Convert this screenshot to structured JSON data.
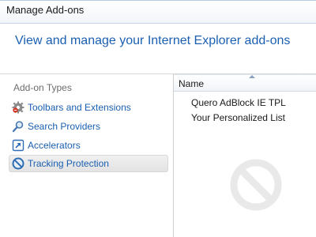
{
  "window": {
    "title": "Manage Add-ons"
  },
  "header": {
    "text": "View and manage your Internet Explorer add-ons"
  },
  "sidebar": {
    "heading": "Add-on Types",
    "items": [
      {
        "label": "Toolbars and Extensions",
        "icon": "gear-icon",
        "selected": false
      },
      {
        "label": "Search Providers",
        "icon": "magnifier-icon",
        "selected": false
      },
      {
        "label": "Accelerators",
        "icon": "accelerator-icon",
        "selected": false
      },
      {
        "label": "Tracking Protection",
        "icon": "no-entry-icon",
        "selected": true
      }
    ]
  },
  "list": {
    "column_header": "Name",
    "rows": [
      {
        "name": "Quero AdBlock IE TPL"
      },
      {
        "name": "Your Personalized List"
      }
    ]
  },
  "colors": {
    "accent_text": "#1b5fb1",
    "selected_bg": "#e8e8e8"
  }
}
